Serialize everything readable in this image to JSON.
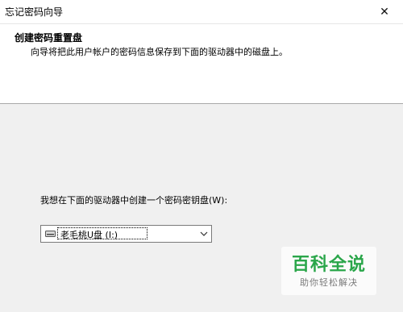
{
  "window": {
    "title": "忘记密码向导",
    "close_symbol": "✕"
  },
  "header": {
    "heading": "创建密码重置盘",
    "description": "向导将把此用户帐户的密码信息保存到下面的驱动器中的磁盘上。"
  },
  "main": {
    "prompt": "我想在下面的驱动器中创建一个密码密钥盘(W):",
    "drive_select": {
      "value": "老毛桃U盘 (I:)",
      "icon": "usb-drive-icon"
    }
  },
  "watermark": {
    "title": "百科全说",
    "subtitle": "助你轻松解决",
    "color": "#2aa64a"
  }
}
